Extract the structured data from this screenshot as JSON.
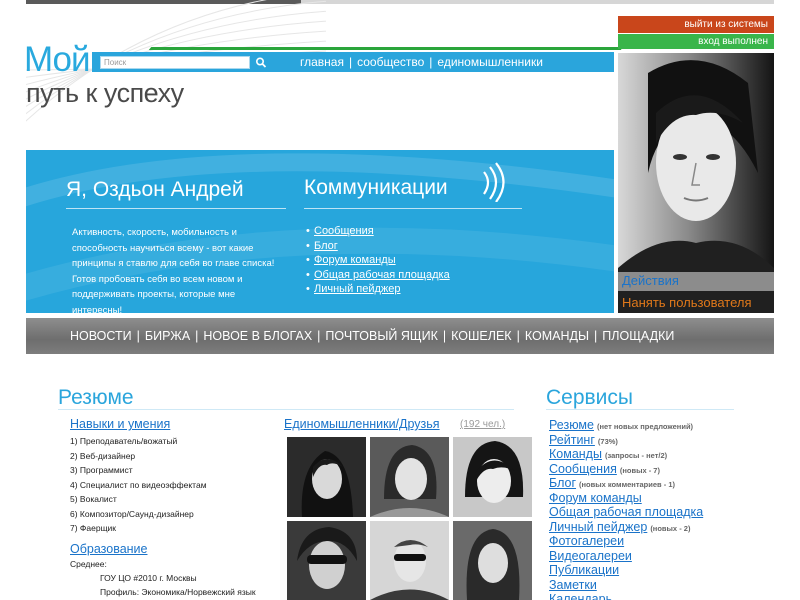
{
  "header": {
    "logo_title": "Мой",
    "logo_subtitle": "путь к успеху",
    "search_placeholder": "Поиск",
    "nav": [
      "главная",
      "сообщество",
      "единомышленники"
    ],
    "logout": "выйти из системы",
    "logged_in": "вход выполнен"
  },
  "banner": {
    "name": "Я, Оздьон Андрей",
    "bio": "Активность, скорость, мобильность и способность научиться всему - вот какие принципы я ставлю для себя во главе списка! Готов пробовать себя во всем новом и поддерживать проекты, которые мне интересны!",
    "comm_title": "Коммуникации",
    "comm_links": [
      "Сообщения",
      "Блог",
      "Форум команды",
      "Общая рабочая площадка",
      "Личный пейджер"
    ]
  },
  "profile_actions": {
    "actions": "Действия",
    "hire": "Нанять пользователя"
  },
  "main_nav": [
    "НОВОСТИ",
    "БИРЖА",
    "НОВОЕ В БЛОГАХ",
    "ПОЧТОВЫЙ ЯЩИК",
    "КОШЕЛЕК",
    "КОМАНДЫ",
    "ПЛОЩАДКИ"
  ],
  "resume": {
    "title": "Резюме",
    "skills_title": "Навыки и умения",
    "skills": [
      "1) Преподаватель/вожатый",
      "2) Веб-дизайнер",
      "3) Программист",
      "4) Специалист по видеоэффектам",
      "5) Вокалист",
      "6) Композитор/Саунд-дизайнер",
      "7) Фаерщик"
    ],
    "education_title": "Образование",
    "education_level": "Среднее:",
    "school": "ГОУ ЦО #2010 г. Москвы",
    "profile": "Профиль: Экономика/Норвежский язык"
  },
  "friends": {
    "title": "Единомышленники/Друзья",
    "count": "(192 чел.)"
  },
  "services": {
    "title": "Сервисы",
    "items": [
      {
        "label": "Резюме",
        "note": "(нет новых предложений)"
      },
      {
        "label": "Рейтинг",
        "note": "(73%)"
      },
      {
        "label": "Команды",
        "note": "(запросы - нет/2)"
      },
      {
        "label": "Сообщения",
        "note": "(новых - 7)"
      },
      {
        "label": "Блог",
        "note": "(новых комментариев - 1)"
      },
      {
        "label": "Форум команды",
        "note": ""
      },
      {
        "label": "Общая рабочая площадка",
        "note": ""
      },
      {
        "label": "Личный пейджер",
        "note": "(новых - 2)"
      },
      {
        "label": "Фотогалереи",
        "note": ""
      },
      {
        "label": "Видеогалереи",
        "note": ""
      },
      {
        "label": "Публикации",
        "note": ""
      },
      {
        "label": "Заметки",
        "note": ""
      },
      {
        "label": "Календарь",
        "note": ""
      }
    ]
  },
  "colors": {
    "accent_blue": "#2aa5dc",
    "link_blue": "#1a73c9",
    "logout_red": "#c9461b",
    "logged_green": "#39b54a",
    "nav_gray": "#7a7a7a"
  }
}
